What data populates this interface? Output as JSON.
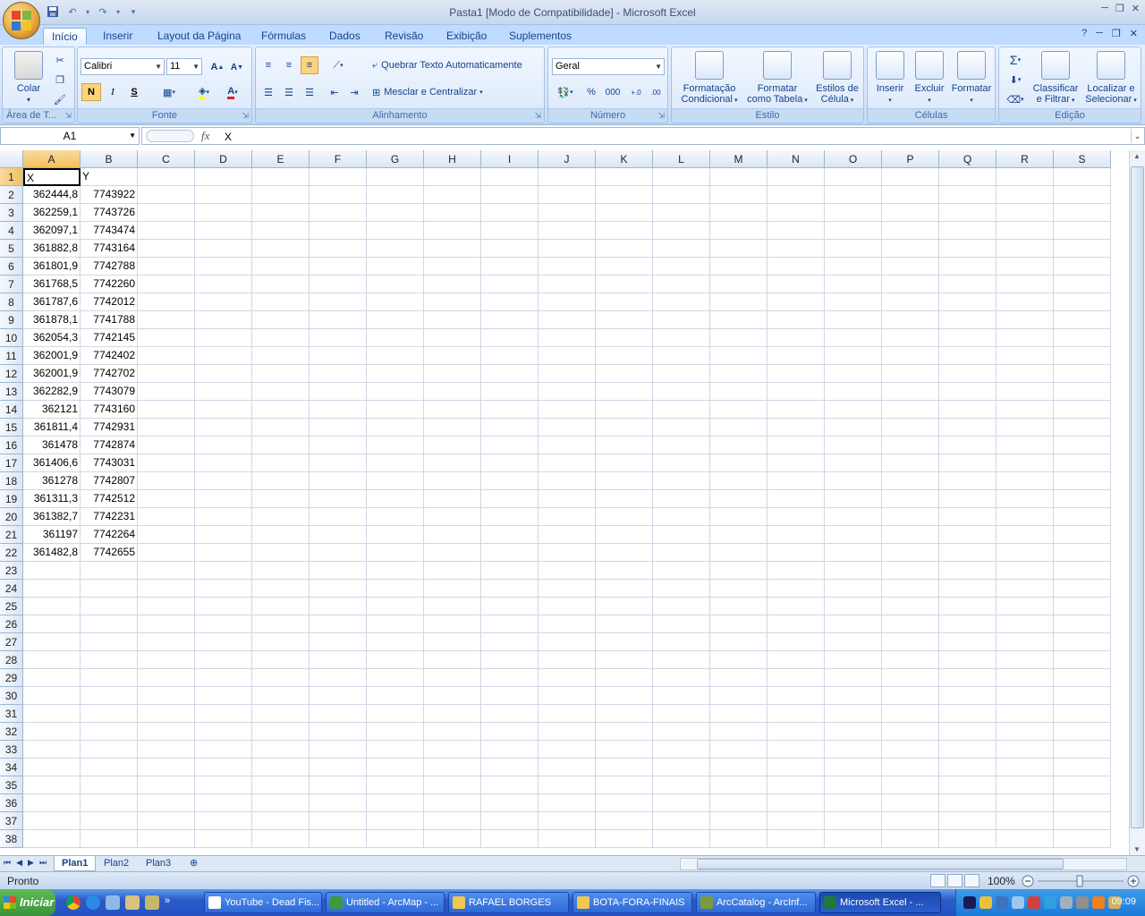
{
  "window": {
    "title": "Pasta1  [Modo de Compatibilidade] - Microsoft Excel"
  },
  "tabs": [
    "Início",
    "Inserir",
    "Layout da Página",
    "Fórmulas",
    "Dados",
    "Revisão",
    "Exibição",
    "Suplementos"
  ],
  "ribbon": {
    "clipboard": {
      "paste": "Colar",
      "label": "Área de T..."
    },
    "font": {
      "name": "Calibri",
      "size": "11",
      "bold": "N",
      "italic": "I",
      "underline": "S",
      "label": "Fonte"
    },
    "alignment": {
      "wrap": "Quebrar Texto Automaticamente",
      "merge": "Mesclar e Centralizar",
      "label": "Alinhamento"
    },
    "number": {
      "format": "Geral",
      "percent": "%",
      "thousands": "000",
      "label": "Número"
    },
    "styles": {
      "conditional_1": "Formatação",
      "conditional_2": "Condicional",
      "table_1": "Formatar",
      "table_2": "como Tabela",
      "cell_1": "Estilos de",
      "cell_2": "Célula",
      "label": "Estilo"
    },
    "cells": {
      "insert": "Inserir",
      "delete": "Excluir",
      "format": "Formatar",
      "label": "Células"
    },
    "editing": {
      "sort_1": "Classificar",
      "sort_2": "e Filtrar",
      "find_1": "Localizar e",
      "find_2": "Selecionar",
      "label": "Edição"
    }
  },
  "formula_bar": {
    "name_box": "A1",
    "fx": "fx",
    "value": "X"
  },
  "grid": {
    "columns": [
      "A",
      "B",
      "C",
      "D",
      "E",
      "F",
      "G",
      "H",
      "I",
      "J",
      "K",
      "L",
      "M",
      "N",
      "O",
      "P",
      "Q",
      "R",
      "S"
    ],
    "headers": {
      "A": "X",
      "B": "Y"
    },
    "rows": [
      {
        "x": "362444,8",
        "y": "7743922"
      },
      {
        "x": "362259,1",
        "y": "7743726"
      },
      {
        "x": "362097,1",
        "y": "7743474"
      },
      {
        "x": "361882,8",
        "y": "7743164"
      },
      {
        "x": "361801,9",
        "y": "7742788"
      },
      {
        "x": "361768,5",
        "y": "7742260"
      },
      {
        "x": "361787,6",
        "y": "7742012"
      },
      {
        "x": "361878,1",
        "y": "7741788"
      },
      {
        "x": "362054,3",
        "y": "7742145"
      },
      {
        "x": "362001,9",
        "y": "7742402"
      },
      {
        "x": "362001,9",
        "y": "7742702"
      },
      {
        "x": "362282,9",
        "y": "7743079"
      },
      {
        "x": "362121",
        "y": "7743160"
      },
      {
        "x": "361811,4",
        "y": "7742931"
      },
      {
        "x": "361478",
        "y": "7742874"
      },
      {
        "x": "361406,6",
        "y": "7743031"
      },
      {
        "x": "361278",
        "y": "7742807"
      },
      {
        "x": "361311,3",
        "y": "7742512"
      },
      {
        "x": "361382,7",
        "y": "7742231"
      },
      {
        "x": "361197",
        "y": "7742264"
      },
      {
        "x": "361482,8",
        "y": "7742655"
      }
    ],
    "row_count": 38
  },
  "sheets": [
    "Plan1",
    "Plan2",
    "Plan3"
  ],
  "status": {
    "text": "Pronto",
    "zoom": "100%"
  },
  "taskbar": {
    "start": "Iniciar",
    "buttons": [
      "YouTube - Dead Fis...",
      "Untitled - ArcMap - ...",
      "RAFAEL BORGES",
      "BOTA-FORA-FINAIS",
      "ArcCatalog - ArcInf...",
      "Microsoft Excel - ..."
    ],
    "clock": "09:09"
  },
  "colors": {
    "ribbon_text": "#15428b",
    "selected_header": "#f1c15f",
    "taskbar": "#2552c3"
  }
}
